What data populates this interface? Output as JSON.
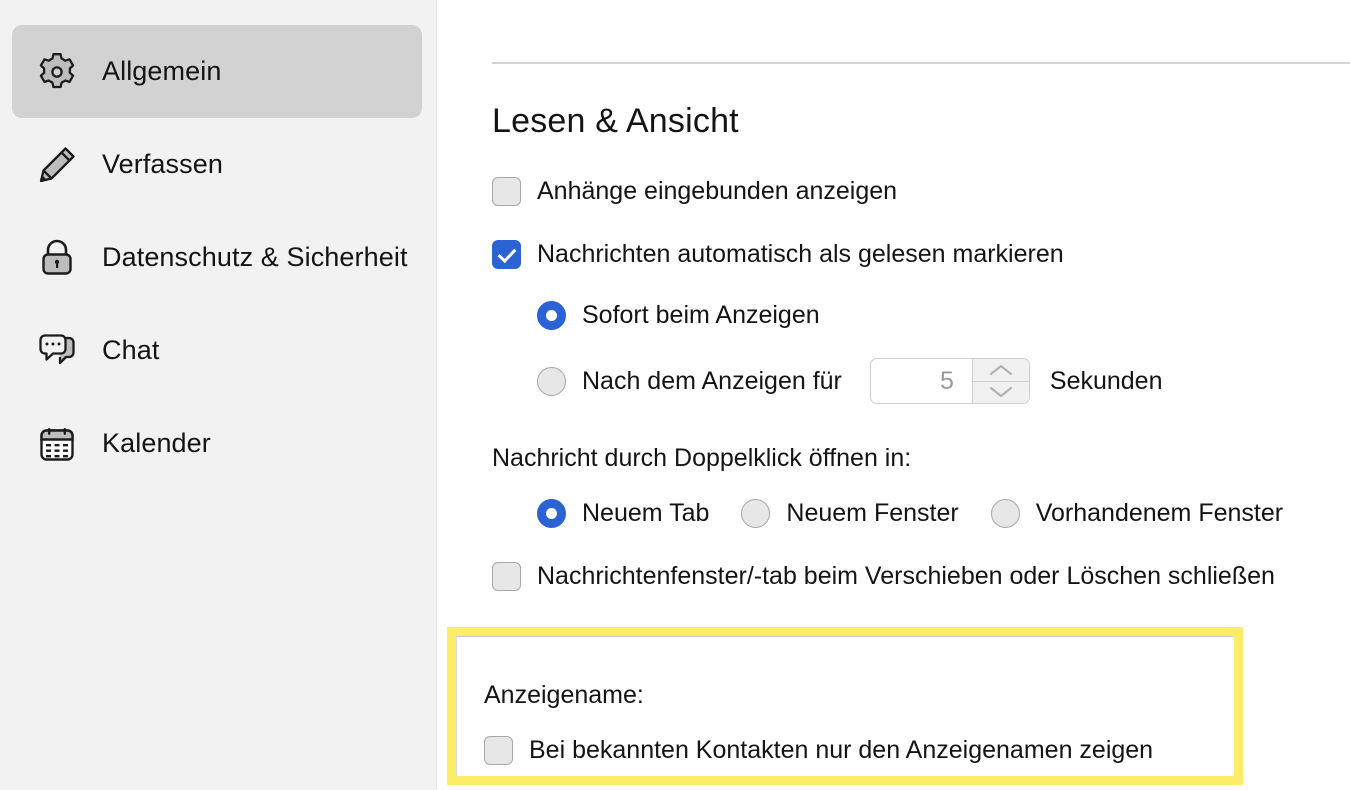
{
  "sidebar": {
    "items": [
      {
        "label": "Allgemein",
        "icon": "gear-icon",
        "selected": true
      },
      {
        "label": "Verfassen",
        "icon": "pencil-icon",
        "selected": false
      },
      {
        "label": "Datenschutz & Sicherheit",
        "icon": "lock-icon",
        "selected": false
      },
      {
        "label": "Chat",
        "icon": "chat-bubble-icon",
        "selected": false
      },
      {
        "label": "Kalender",
        "icon": "calendar-icon",
        "selected": false
      }
    ]
  },
  "main": {
    "section_title": "Lesen & Ansicht",
    "attachments_inline": {
      "label": "Anhänge eingebunden anzeigen",
      "checked": false
    },
    "mark_as_read": {
      "label": "Nachrichten automatisch als gelesen markieren",
      "checked": true
    },
    "mark_immediately": {
      "label": "Sofort beim Anzeigen",
      "selected": true
    },
    "mark_after_delay": {
      "label": "Nach dem Anzeigen für",
      "selected": false,
      "seconds_value": "5",
      "seconds_suffix": "Sekunden",
      "spinner_up_icon": "chevron-up-icon",
      "spinner_down_icon": "chevron-down-icon"
    },
    "open_doubleclick": {
      "label": "Nachricht durch Doppelklick öffnen in:",
      "options": [
        {
          "label": "Neuem Tab",
          "selected": true
        },
        {
          "label": "Neuem Fenster",
          "selected": false
        },
        {
          "label": "Vorhandenem Fenster",
          "selected": false
        }
      ]
    },
    "close_window_on_move": {
      "label": "Nachrichtenfenster/-tab beim Verschieben oder Löschen schließen",
      "checked": false
    },
    "display_name_section": {
      "label": "Anzeigename:",
      "checkbox_label": "Bei bekannten Kontakten nur den Anzeigenamen zeigen",
      "checked": false,
      "highlight_color": "#fbed65"
    }
  },
  "colors": {
    "accent_blue": "#2b63d4",
    "sidebar_bg": "#f2f2f2",
    "selected_item_bg": "#d2d2d2",
    "highlight_yellow": "#fbed65",
    "text": "#141414"
  }
}
